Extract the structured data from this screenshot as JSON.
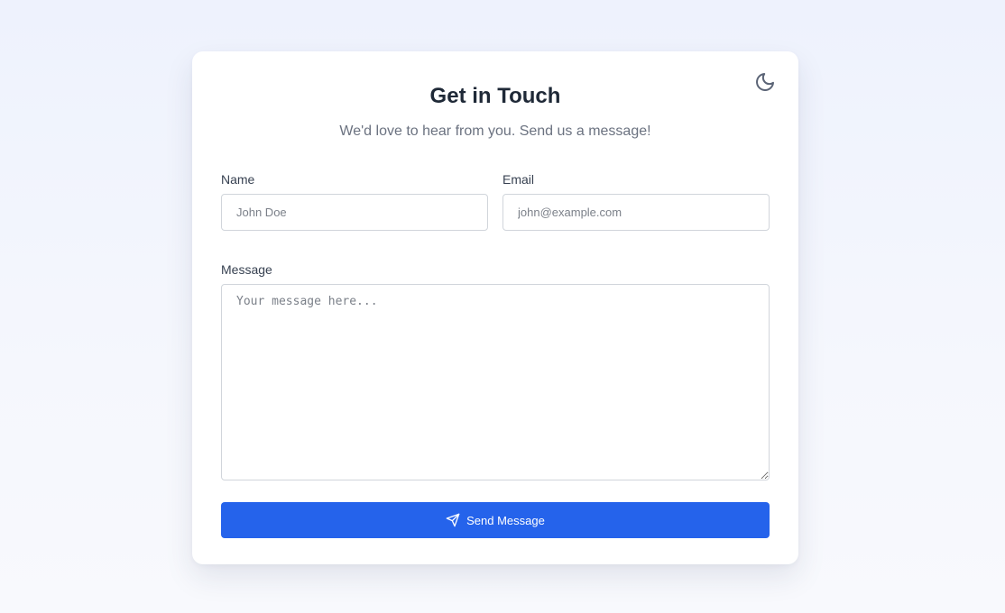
{
  "card": {
    "title": "Get in Touch",
    "subtitle": "We'd love to hear from you. Send us a message!",
    "theme_toggle_icon": "moon-icon"
  },
  "form": {
    "name": {
      "label": "Name",
      "placeholder": "John Doe",
      "value": ""
    },
    "email": {
      "label": "Email",
      "placeholder": "john@example.com",
      "value": ""
    },
    "message": {
      "label": "Message",
      "placeholder": "Your message here...",
      "value": ""
    },
    "submit": {
      "label": "Send Message",
      "icon": "send-icon"
    }
  },
  "colors": {
    "accent": "#2563eb",
    "title": "#1f2937",
    "subtitle": "#6b7280",
    "border": "#d1d5db"
  }
}
